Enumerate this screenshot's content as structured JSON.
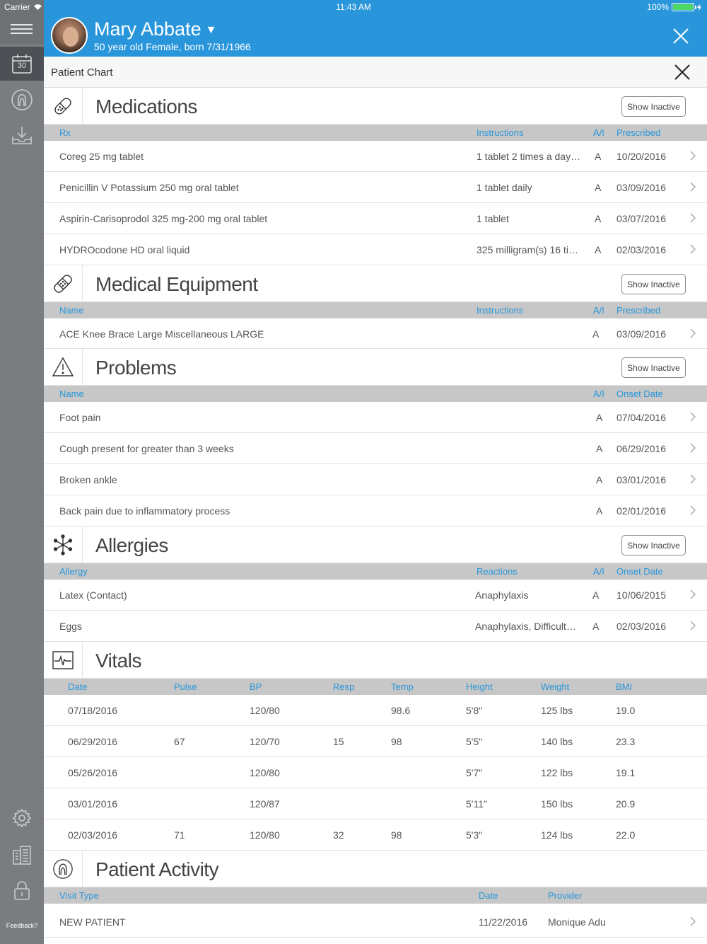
{
  "status_bar": {
    "carrier": "Carrier",
    "time": "11:43 AM",
    "battery": "100%"
  },
  "sidebar": {
    "calendar_day": "30",
    "feedback": "Feedback?"
  },
  "patient": {
    "name": "Mary Abbate",
    "subtitle": "50 year old Female, born 7/31/1966"
  },
  "chart": {
    "title": "Patient Chart"
  },
  "show_inactive_label": "Show Inactive",
  "medications": {
    "title": "Medications",
    "columns": {
      "rx": "Rx",
      "instructions": "Instructions",
      "ai": "A/I",
      "prescribed": "Prescribed"
    },
    "rows": [
      {
        "name": "Coreg 25 mg tablet",
        "instructions": "1 tablet 2 times a day…",
        "ai": "A",
        "date": "10/20/2016"
      },
      {
        "name": "Penicillin V Potassium 250 mg oral tablet",
        "instructions": "1 tablet daily",
        "ai": "A",
        "date": "03/09/2016"
      },
      {
        "name": "Aspirin-Carisoprodol 325 mg-200 mg oral tablet",
        "instructions": "1 tablet",
        "ai": "A",
        "date": "03/07/2016"
      },
      {
        "name": "HYDROcodone HD oral liquid",
        "instructions": "325 milligram(s) 16 ti…",
        "ai": "A",
        "date": "02/03/2016"
      }
    ]
  },
  "equipment": {
    "title": "Medical Equipment",
    "columns": {
      "name": "Name",
      "instructions": "Instructions",
      "ai": "A/I",
      "prescribed": "Prescribed"
    },
    "rows": [
      {
        "name": "ACE Knee Brace Large Miscellaneous LARGE",
        "ai": "A",
        "date": "03/09/2016"
      }
    ]
  },
  "problems": {
    "title": "Problems",
    "columns": {
      "name": "Name",
      "ai": "A/I",
      "onset": "Onset Date"
    },
    "rows": [
      {
        "name": "Foot pain",
        "ai": "A",
        "date": "07/04/2016"
      },
      {
        "name": "Cough present for greater than 3 weeks",
        "ai": "A",
        "date": "06/29/2016"
      },
      {
        "name": "Broken ankle",
        "ai": "A",
        "date": "03/01/2016"
      },
      {
        "name": "Back pain due to inflammatory process",
        "ai": "A",
        "date": "02/01/2016"
      }
    ]
  },
  "allergies": {
    "title": "Allergies",
    "columns": {
      "allergy": "Allergy",
      "reactions": "Reactions",
      "ai": "A/I",
      "onset": "Onset Date"
    },
    "rows": [
      {
        "name": "Latex (Contact)",
        "reactions": "Anaphylaxis",
        "ai": "A",
        "date": "10/06/2015"
      },
      {
        "name": "Eggs",
        "reactions": "Anaphylaxis, Difficult…",
        "ai": "A",
        "date": "02/03/2016"
      }
    ]
  },
  "vitals": {
    "title": "Vitals",
    "columns": {
      "date": "Date",
      "pulse": "Pulse",
      "bp": "BP",
      "resp": "Resp",
      "temp": "Temp",
      "height": "Height",
      "weight": "Weight",
      "bmi": "BMI"
    },
    "rows": [
      {
        "date": "07/18/2016",
        "pulse": "",
        "bp": "120/80",
        "resp": "",
        "temp": "98.6",
        "height": "5'8\"",
        "weight": "125 lbs",
        "bmi": "19.0"
      },
      {
        "date": "06/29/2016",
        "pulse": "67",
        "bp": "120/70",
        "resp": "15",
        "temp": "98",
        "height": "5'5\"",
        "weight": "140 lbs",
        "bmi": "23.3"
      },
      {
        "date": "05/26/2016",
        "pulse": "",
        "bp": "120/80",
        "resp": "",
        "temp": "",
        "height": "5'7\"",
        "weight": "122 lbs",
        "bmi": "19.1"
      },
      {
        "date": "03/01/2016",
        "pulse": "",
        "bp": "120/87",
        "resp": "",
        "temp": "",
        "height": "5'11\"",
        "weight": "150 lbs",
        "bmi": "20.9"
      },
      {
        "date": "02/03/2016",
        "pulse": "71",
        "bp": "120/80",
        "resp": "32",
        "temp": "98",
        "height": "5'3\"",
        "weight": "124 lbs",
        "bmi": "22.0"
      }
    ]
  },
  "activity": {
    "title": "Patient Activity",
    "columns": {
      "visit_type": "Visit Type",
      "date": "Date",
      "provider": "Provider"
    },
    "rows": [
      {
        "visit_type": "NEW PATIENT",
        "date": "11/22/2016",
        "provider": "Monique Adu"
      }
    ]
  },
  "colors": {
    "header_blue": "#2996db",
    "sidebar_gray": "#7a7d80",
    "column_header_gray": "#c7c7c7"
  },
  "icons": [
    "hamburger-icon",
    "calendar-icon",
    "patient-icon",
    "inbox-icon",
    "gear-icon",
    "building-icon",
    "lock-icon",
    "close-icon",
    "pill-icon",
    "bandage-icon",
    "warning-icon",
    "allergy-icon",
    "vitals-icon",
    "chevron-right-icon"
  ]
}
